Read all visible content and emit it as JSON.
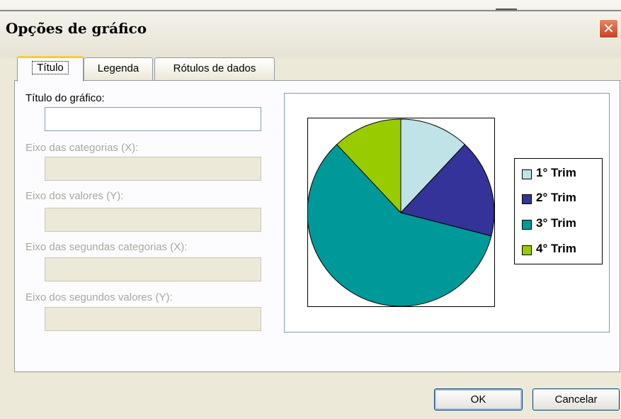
{
  "window": {
    "title": "Opções de gráfico",
    "close_icon": "close-icon"
  },
  "tabs": [
    {
      "label": "Título",
      "active": true
    },
    {
      "label": "Legenda",
      "active": false
    },
    {
      "label": "Rótulos de dados",
      "active": false
    }
  ],
  "form": {
    "chart_title_label": "Título do gráfico:",
    "chart_title_value": "",
    "category_axis_label": "Eixo das categorias (X):",
    "value_axis_label": "Eixo dos valores (Y):",
    "secondary_category_axis_label": "Eixo das segundas categorias (X):",
    "secondary_value_axis_label": "Eixo dos segundos valores (Y):"
  },
  "chart_data": {
    "type": "pie",
    "categories": [
      "1° Trim",
      "2° Trim",
      "3° Trim",
      "4° Trim"
    ],
    "values": [
      12,
      17,
      59,
      12
    ],
    "colors": [
      "#bfe3e6",
      "#333399",
      "#009999",
      "#99cc00"
    ],
    "legend_position": "right"
  },
  "buttons": {
    "ok": "OK",
    "cancel": "Cancelar"
  }
}
